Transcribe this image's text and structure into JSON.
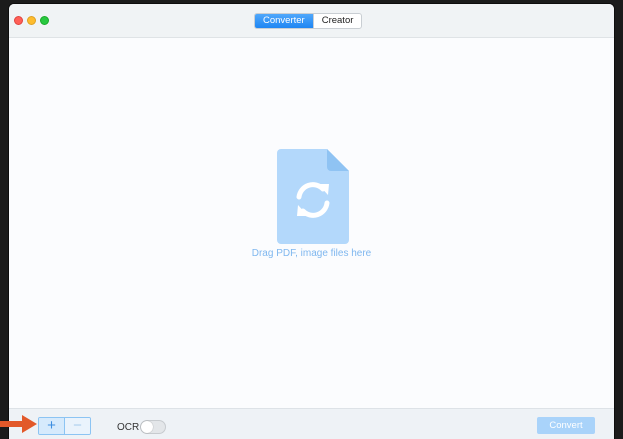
{
  "titlebar": {
    "tabs": [
      {
        "label": "Converter",
        "active": true
      },
      {
        "label": "Creator",
        "active": false
      }
    ]
  },
  "dropzone": {
    "hint": "Drag PDF, image files here",
    "icon": "file-convert-icon"
  },
  "bottombar": {
    "add_label": "+",
    "remove_label": "−",
    "ocr_label": "OCR",
    "ocr_enabled": false,
    "convert_label": "Convert"
  },
  "colors": {
    "accent": "#1f86f3",
    "convert_disabled": "#a9d3fa",
    "hint_text": "#7fb7ef",
    "annotation_arrow": "#e2592a"
  }
}
